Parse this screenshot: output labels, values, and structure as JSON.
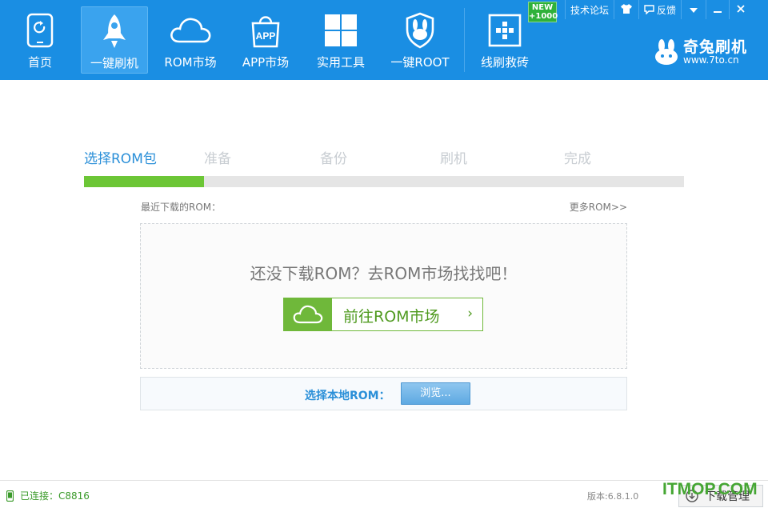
{
  "nav": {
    "items": [
      {
        "label": "首页",
        "icon": "phone-refresh-icon"
      },
      {
        "label": "一键刷机",
        "icon": "rocket-icon"
      },
      {
        "label": "ROM市场",
        "icon": "cloud-icon"
      },
      {
        "label": "APP市场",
        "icon": "shopping-bag-icon",
        "icon_text": "APP"
      },
      {
        "label": "实用工具",
        "icon": "grid-icon"
      },
      {
        "label": "一键ROOT",
        "icon": "rabbit-shield-icon"
      },
      {
        "label": "线刷救砖",
        "icon": "brick-plus-icon"
      }
    ],
    "active_index": 1
  },
  "badge": {
    "line1": "NEW",
    "line2": "+1000"
  },
  "topbar": {
    "forum": "技术论坛",
    "feedback": "反馈",
    "shirt_icon": "tshirt-icon",
    "chat_icon": "speech-bubble-icon"
  },
  "brand": {
    "name": "奇兔刷机",
    "url": "www.7to.cn"
  },
  "steps": [
    {
      "label": "选择ROM包",
      "state": "active"
    },
    {
      "label": "准备",
      "state": "pending"
    },
    {
      "label": "备份",
      "state": "pending"
    },
    {
      "label": "刷机",
      "state": "pending"
    },
    {
      "label": "完成",
      "state": "pending"
    }
  ],
  "progress": {
    "fraction": 0.2
  },
  "rom": {
    "recent_label": "最近下载的ROM：",
    "more_link": "更多ROM>>",
    "empty_text": "还没下载ROM？去ROM市场找找吧！",
    "go_button": "前往ROM市场",
    "go_arrow": "›"
  },
  "local": {
    "label": "选择本地ROM：",
    "browse": "浏览..."
  },
  "footer": {
    "status": "已连接：C8816",
    "version": "版本:6.8.1.0",
    "download_manager": "下载管理",
    "watermark": "ITMOP.COM"
  },
  "colors": {
    "header": "#1a8ee3",
    "active_step": "#2a8fd8",
    "progress": "#6cc636",
    "go_button": "#6fb83a"
  }
}
